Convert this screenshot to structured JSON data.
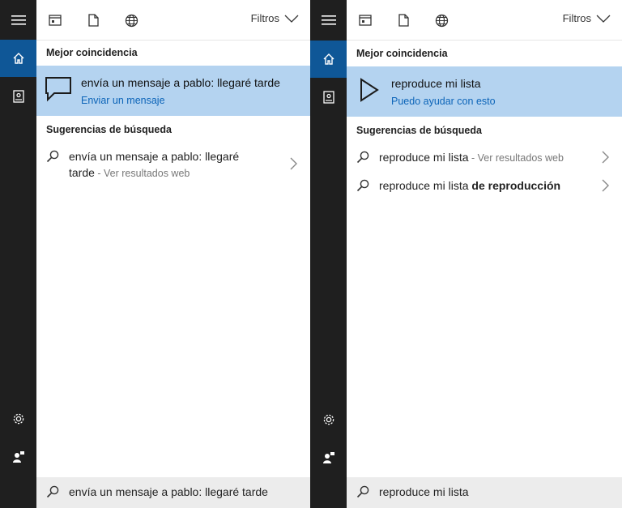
{
  "colors": {
    "rail": "#1f1f1f",
    "rail_active": "#0f5797",
    "highlight": "#b4d3f0",
    "link": "#0c64b8",
    "search_bg": "#ececec"
  },
  "icons": [
    "menu-icon",
    "home-icon",
    "notebook-icon",
    "settings-icon",
    "feedback-icon",
    "apps-icon",
    "document-icon",
    "web-icon",
    "chevron-down-icon",
    "chat-bubble-icon",
    "play-icon",
    "search-icon",
    "chevron-right-icon"
  ],
  "left": {
    "filters_label": "Filtros",
    "best_heading": "Mejor coincidencia",
    "best_title": "envía un mensaje a pablo: llegaré tarde",
    "best_sub": "Enviar un mensaje",
    "sugg_heading": "Sugerencias de búsqueda",
    "suggestions": [
      {
        "line1": "envía un mensaje a pablo: llegaré",
        "line2": "tarde",
        "sub": " - Ver resultados web"
      }
    ],
    "search_value": "envía un mensaje a pablo: llegaré tarde"
  },
  "right": {
    "filters_label": "Filtros",
    "best_heading": "Mejor coincidencia",
    "best_title": "reproduce mi lista",
    "best_sub": "Puedo ayudar con esto",
    "sugg_heading": "Sugerencias de búsqueda",
    "suggestions": [
      {
        "text": "reproduce mi lista",
        "sub": " - Ver resultados web"
      },
      {
        "text": "reproduce mi lista ",
        "bold": "de reproducción"
      }
    ],
    "search_value": "reproduce mi lista"
  }
}
